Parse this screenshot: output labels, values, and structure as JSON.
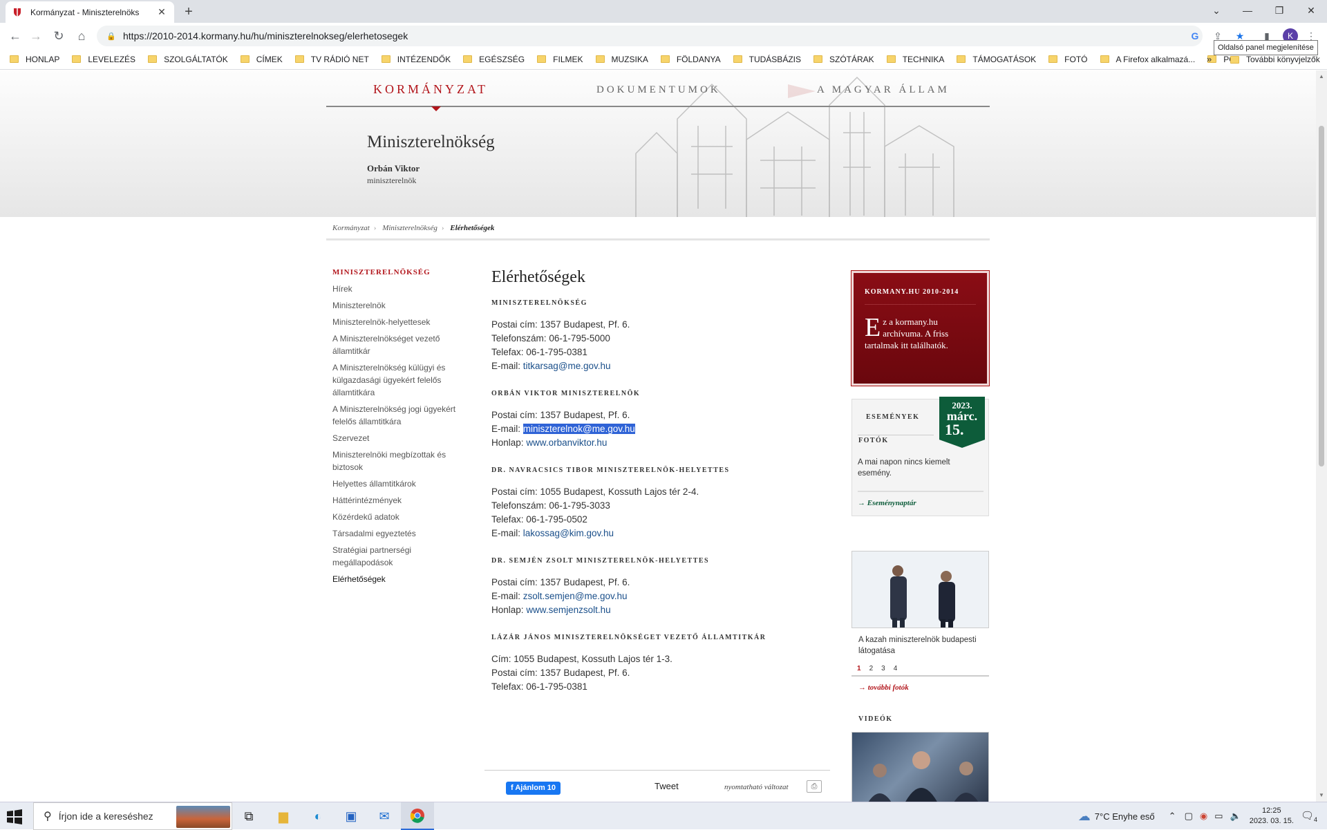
{
  "browser": {
    "tab_title": "Kormányzat - Miniszterelnöks",
    "url": "https://2010-2014.kormany.hu/hu/miniszterelnokseg/elerhetosegek",
    "profile_initial": "K",
    "tooltip": "Oldalsó panel megjelenítése",
    "bookmarks": [
      "HONLAP",
      "LEVELEZÉS",
      "SZOLGÁLTATÓK",
      "CÍMEK",
      "TV RÁDIÓ NET",
      "INTÉZENDŐK",
      "EGÉSZSÉG",
      "FILMEK",
      "MUZSIKA",
      "FÖLDANYA",
      "TUDÁSBÁZIS",
      "SZÓTÁRAK",
      "TECHNIKA",
      "TÁMOGATÁSOK",
      "FOTÓ",
      "A Firefox alkalmazá...",
      "PC"
    ],
    "more_bookmarks": "»",
    "other_bookmarks": "További könyvjelzők"
  },
  "site": {
    "nav": [
      "KORMÁNYZAT",
      "DOKUMENTUMOK",
      "A MAGYAR ÁLLAM"
    ],
    "title": "Miniszterelnökség",
    "pm_name": "Orbán Viktor",
    "pm_role": "miniszterelnök"
  },
  "breadcrumb": [
    "Kormányzat",
    "Miniszterelnökség",
    "Elérhetőségek"
  ],
  "sidebar": {
    "heading": "MINISZTERELNÖKSÉG",
    "items": [
      "Hírek",
      "Miniszterelnök",
      "Miniszterelnök-helyettesek",
      "A Miniszterelnökséget vezető államtitkár",
      "A Miniszterelnökség külügyi és külgazdasági ügyekért felelős államtitkára",
      "A Miniszterelnökség jogi ügyekért felelős államtitkára",
      "Szervezet",
      "Miniszterelnöki megbízottak és biztosok",
      "Helyettes államtitkárok",
      "Háttérintézmények",
      "Közérdekű adatok",
      "Társadalmi egyeztetés",
      "Stratégiai partnerségi megállapodások",
      "Elérhetőségek"
    ]
  },
  "main": {
    "title": "Elérhetőségek",
    "sections": [
      {
        "heading": "MINISZTERELNÖKSÉG",
        "lines": [
          {
            "label": "Postai cím:",
            "value": "1357 Budapest, Pf. 6."
          },
          {
            "label": "Telefonszám:",
            "value": "06-1-795-5000"
          },
          {
            "label": "Telefax:",
            "value": "06-1-795-0381"
          },
          {
            "label": "E-mail:",
            "link": "titkarsag@me.gov.hu"
          }
        ]
      },
      {
        "heading": "ORBÁN VIKTOR MINISZTERELNÖK",
        "lines": [
          {
            "label": "Postai cím:",
            "value": "1357 Budapest, Pf. 6."
          },
          {
            "label": "E-mail:",
            "link": "miniszterelnok@me.gov.hu"
          },
          {
            "label": "Honlap:",
            "link": "www.orbanviktor.hu"
          }
        ]
      },
      {
        "heading": "DR. NAVRACSICS TIBOR MINISZTERELNÖK-HELYETTES",
        "lines": [
          {
            "label": "Postai cím:",
            "value": "1055 Budapest, Kossuth Lajos tér 2-4."
          },
          {
            "label": "Telefonszám:",
            "value": "06-1-795-3033"
          },
          {
            "label": "Telefax:",
            "value": "06-1-795-0502"
          },
          {
            "label": "E-mail:",
            "link": "lakossag@kim.gov.hu"
          }
        ]
      },
      {
        "heading": "DR. SEMJÉN ZSOLT MINISZTERELNÖK-HELYETTES",
        "lines": [
          {
            "label": "Postai cím:",
            "value": "1357 Budapest, Pf. 6."
          },
          {
            "label": "E-mail:",
            "link": "zsolt.semjen@me.gov.hu"
          },
          {
            "label": "Honlap:",
            "link": "www.semjenzsolt.hu"
          }
        ]
      },
      {
        "heading": "LÁZÁR JÁNOS MINISZTERELNÖKSÉGET VEZETŐ ÁLLAMTITKÁR",
        "lines": [
          {
            "label": "Cím:",
            "value": "1055 Budapest, Kossuth Lajos tér 1-3."
          },
          {
            "label": "Postai cím:",
            "value": "1357 Budapest, Pf. 6."
          },
          {
            "label": "Telefax:",
            "value": "06-1-795-0381"
          }
        ]
      }
    ],
    "selected_email": "miniszterelnok@me.gov.hu"
  },
  "share": {
    "fb_label": "Ajánlom 10",
    "tweet_label": "Tweet",
    "print_label": "nyomtatható változat"
  },
  "right": {
    "archive_heading": "KORMANY.HU 2010-2014",
    "archive_dropcap": "E",
    "archive_text": "z a kormany.hu archívuma. A friss tartalmak itt találhatók.",
    "events_heading": "ESEMÉNYEK",
    "events_year": "2023.",
    "events_month": "márc.",
    "events_day": "15.",
    "events_msg": "A mai napon nincs kiemelt esemény.",
    "events_link": "→ Eseménynaptár",
    "photos_heading": "FOTÓK",
    "photo_caption": "A kazah miniszterelnök budapesti látogatása",
    "pager": [
      "1",
      "2",
      "3",
      "4"
    ],
    "more_photos": "→ további fotók",
    "videos_heading": "VIDEÓK"
  },
  "taskbar": {
    "search_placeholder": "Írjon ide a kereséshez",
    "weather": "7°C  Enyhe eső",
    "time": "12:25",
    "date": "2023. 03. 15.",
    "notif_count": "4"
  }
}
